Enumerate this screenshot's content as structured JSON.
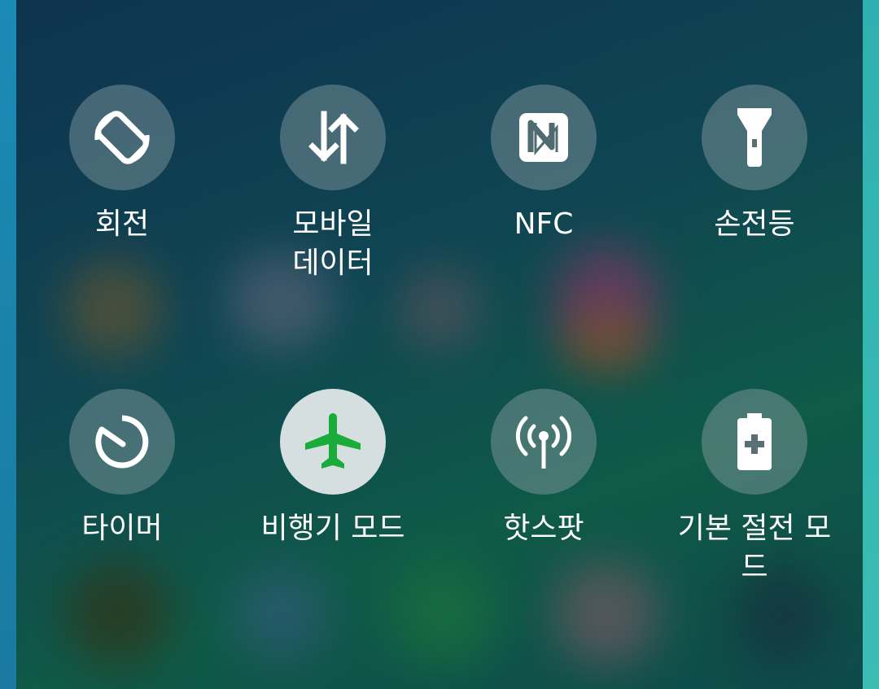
{
  "quick_settings": {
    "tiles": [
      {
        "label": "회전",
        "icon": "rotation-icon",
        "active": false
      },
      {
        "label": "모바일\n데이터",
        "icon": "mobile-data-icon",
        "active": false
      },
      {
        "label": "NFC",
        "icon": "nfc-icon",
        "active": false
      },
      {
        "label": "손전등",
        "icon": "flashlight-icon",
        "active": false
      },
      {
        "label": "타이머",
        "icon": "timer-icon",
        "active": false
      },
      {
        "label": "비행기 모드",
        "icon": "airplane-icon",
        "active": true
      },
      {
        "label": "핫스팟",
        "icon": "hotspot-icon",
        "active": false
      },
      {
        "label": "기본 절전 모드",
        "icon": "battery-saver-icon",
        "active": false
      }
    ]
  },
  "colors": {
    "active_icon": "#1aab3a",
    "active_circle": "#d6dfdf",
    "icon": "#ffffff"
  }
}
